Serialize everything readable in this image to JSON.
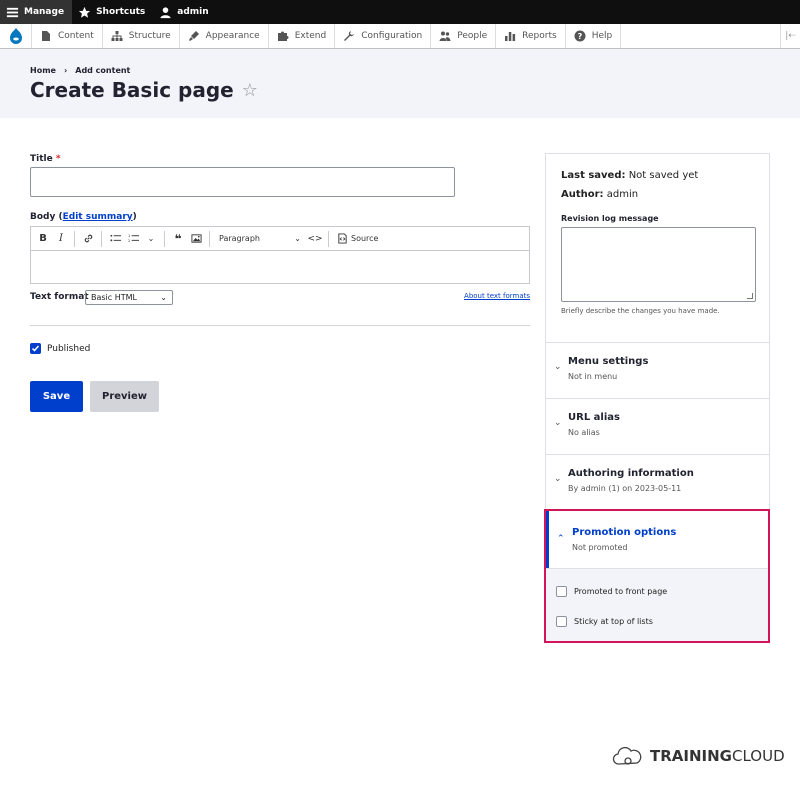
{
  "toolbar": {
    "manage": "Manage",
    "shortcuts": "Shortcuts",
    "user": "admin"
  },
  "menu": {
    "items": [
      "Content",
      "Structure",
      "Appearance",
      "Extend",
      "Configuration",
      "People",
      "Reports",
      "Help"
    ]
  },
  "header": {
    "breadcrumb": [
      "Home",
      "Add content"
    ],
    "breadcrumb_sep": "›",
    "title": "Create Basic page",
    "favorite_icon": "☆"
  },
  "form": {
    "title_label": "Title",
    "title_required": "*",
    "title_value": "",
    "body_label": "Body (",
    "body_link": "Edit summary",
    "body_label_end": ")",
    "editor": {
      "paragraph": "Paragraph",
      "source": "Source"
    },
    "text_format_label": "Text format",
    "text_format_value": "Basic HTML",
    "about_text_formats": "About text formats",
    "published_label": "Published",
    "published_checked": true,
    "save": "Save",
    "preview": "Preview"
  },
  "sidebar": {
    "last_saved_label": "Last saved:",
    "last_saved_value": "Not saved yet",
    "author_label": "Author:",
    "author_value": "admin",
    "revision_label": "Revision log message",
    "revision_value": "",
    "revision_desc": "Briefly describe the changes you have made.",
    "sections": [
      {
        "title": "Menu settings",
        "summary": "Not in menu"
      },
      {
        "title": "URL alias",
        "summary": "No alias"
      },
      {
        "title": "Authoring information",
        "summary": "By admin (1) on 2023-05-11"
      }
    ],
    "promotion": {
      "title": "Promotion options",
      "summary": "Not promoted",
      "options": [
        "Promoted to front page",
        "Sticky at top of lists"
      ]
    }
  },
  "brand": {
    "part1": "TRAINING",
    "part2": "CLOUD"
  },
  "colors": {
    "accent": "#003ecc",
    "highlight": "#d4145a",
    "header_bg": "#f3f4f9"
  }
}
